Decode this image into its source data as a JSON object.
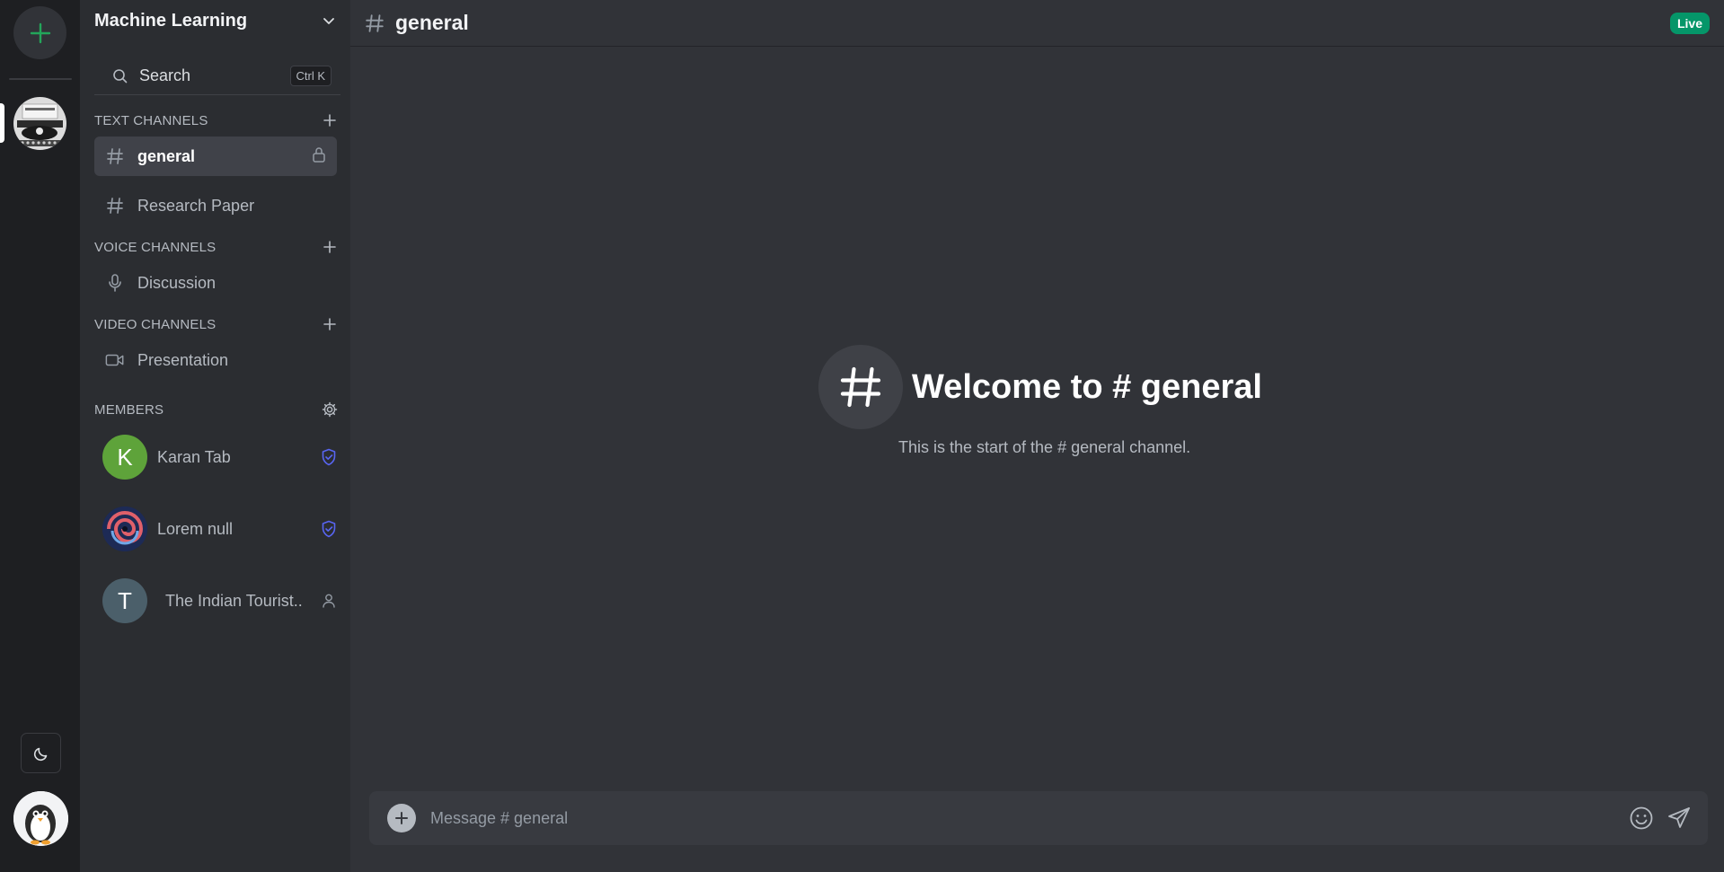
{
  "server": {
    "name": "Machine Learning",
    "search_label": "Search",
    "search_shortcut": "Ctrl K"
  },
  "sections": {
    "text": "TEXT CHANNELS",
    "voice": "VOICE CHANNELS",
    "video": "VIDEO CHANNELS",
    "members": "MEMBERS"
  },
  "channels": {
    "text": [
      {
        "name": "general",
        "active": true,
        "locked": true
      },
      {
        "name": "Research Paper",
        "active": false
      }
    ],
    "voice": [
      {
        "name": "Discussion"
      }
    ],
    "video": [
      {
        "name": "Presentation"
      }
    ]
  },
  "members": [
    {
      "name": "Karan Tab",
      "initial": "K",
      "avatar_color": "#5ea33a",
      "role_icon": "shield-check-icon"
    },
    {
      "name": "Lorem null",
      "initial": "",
      "avatar_color": "#1d2a55",
      "role_icon": "shield-check-icon"
    },
    {
      "name": "The Indian Tourist..",
      "initial": "T",
      "avatar_color": "#4b5f6a",
      "role_icon": "user-icon"
    }
  ],
  "header": {
    "channel_name": "general",
    "live_badge": "Live"
  },
  "welcome": {
    "title": "Welcome to # general",
    "subtitle": "This is the start of the # general channel."
  },
  "composer": {
    "placeholder": "Message # general"
  },
  "colors": {
    "accent_green": "#23a55a",
    "live_green": "#059669",
    "shield_purple": "#5865f2"
  }
}
